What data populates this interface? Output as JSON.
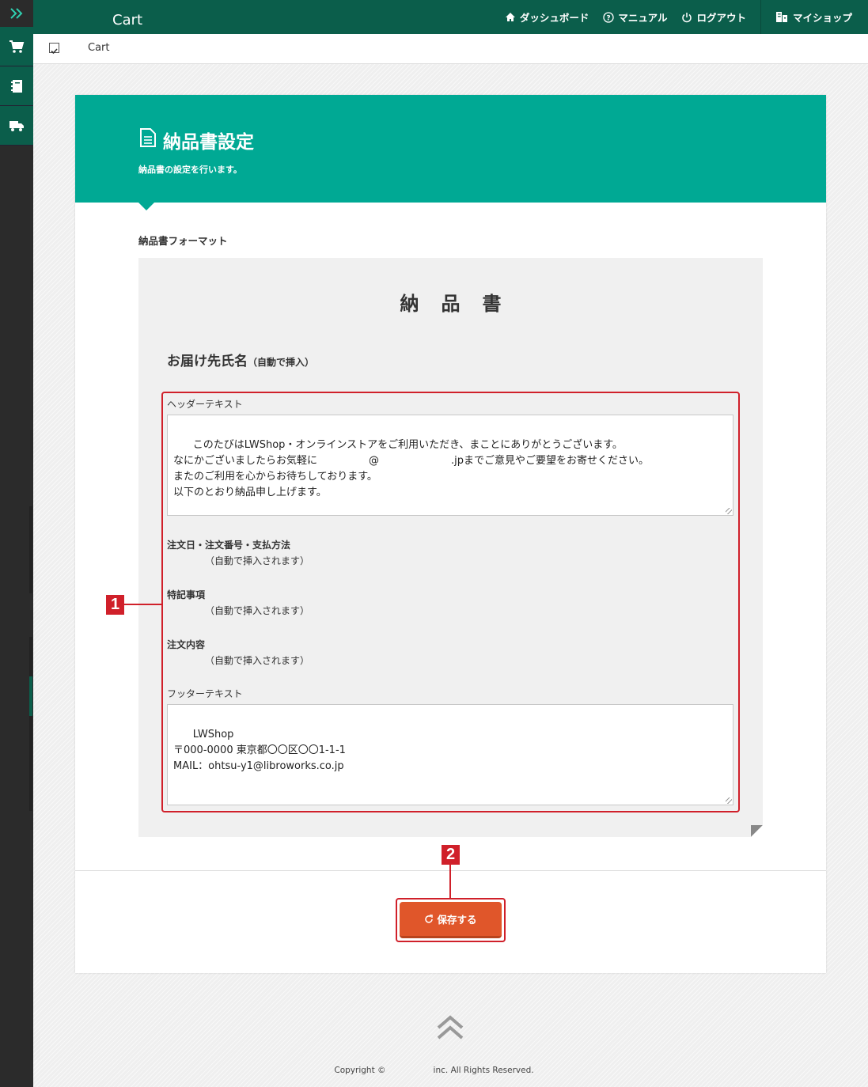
{
  "app": {
    "title": "Cart"
  },
  "topnav": {
    "dashboard": "ダッシュボード",
    "manual": "マニュアル",
    "logout": "ログアウト",
    "myshop": "マイショップ"
  },
  "sidebar": {
    "items": [
      "toggle",
      "cart",
      "notebook",
      "truck"
    ]
  },
  "breadcrumb": {
    "label": "Cart"
  },
  "panel": {
    "title": "納品書設定",
    "subtitle": "納品書の設定を行います。"
  },
  "section": {
    "label": "納品書フォーマット"
  },
  "document": {
    "title": "納品書",
    "recipient": "お届け先氏名",
    "recipient_note": "（自動で挿入）",
    "header_label": "ヘッダーテキスト",
    "header_text": "このたびはLWShop・オンラインストアをご利用いただき、まことにありがとうございます。\nなにかございましたらお気軽に　　　　　@　　　　　　　.jpまでご意見やご要望をお寄せください。\nまたのご利用を心からお待ちしております。\n以下のとおり納品申し上げます。",
    "order_info_title": "注文日・注文番号・支払方法",
    "order_info_note": "（自動で挿入されます）",
    "remarks_title": "特記事項",
    "remarks_note": "（自動で挿入されます）",
    "contents_title": "注文内容",
    "contents_note": "（自動で挿入されます）",
    "footer_label": "フッターテキスト",
    "footer_text": "LWShop\n〒000-0000 東京都〇〇区〇〇1-1-1\nMAIL：ohtsu-y1@libroworks.co.jp"
  },
  "save_button": {
    "label": "保存する"
  },
  "callouts": [
    "1",
    "2"
  ],
  "footer": {
    "copyright_left": "Copyright ©",
    "copyright_right": "inc. All Rights Reserved."
  },
  "colors": {
    "brand": "#0b5e4b",
    "header": "#00a994",
    "accent": "#e0562a",
    "callout": "#d0202a"
  }
}
